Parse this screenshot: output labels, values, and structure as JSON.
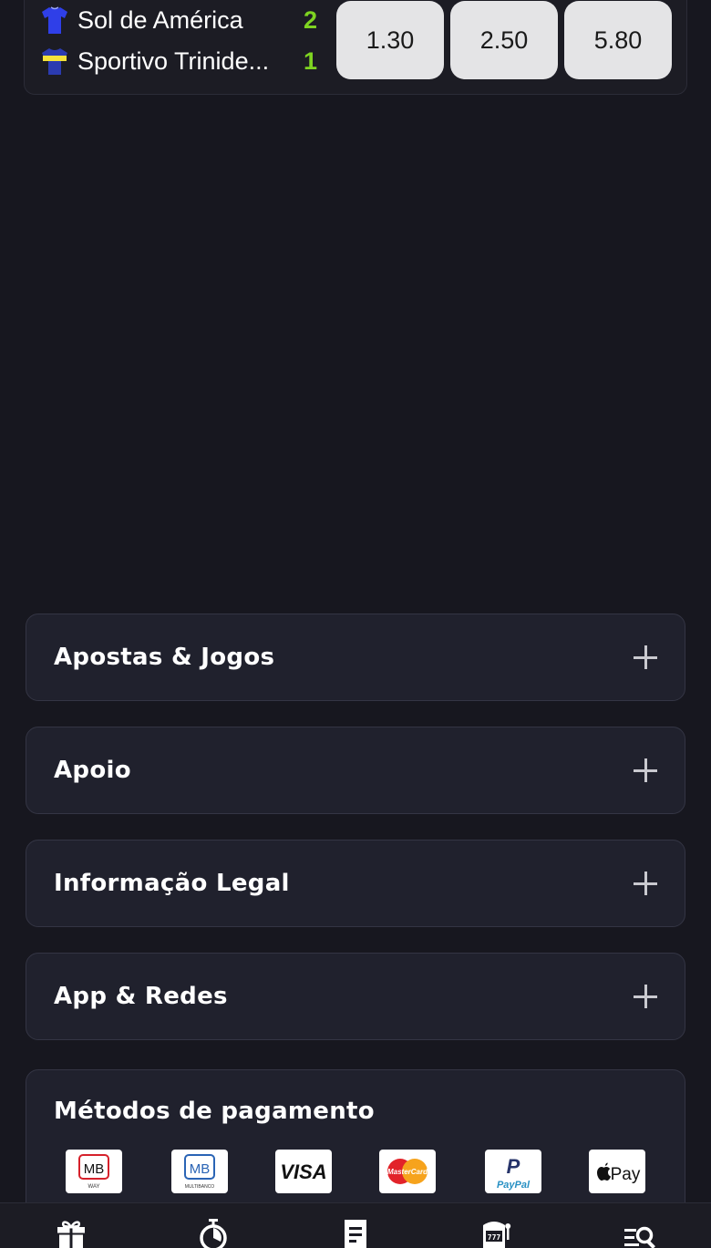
{
  "match": {
    "home": {
      "name": "Sol de América",
      "score": "2"
    },
    "away": {
      "name": "Sportivo Trinide...",
      "score": "1"
    },
    "odds": [
      "1.30",
      "2.50",
      "5.80"
    ]
  },
  "footer": {
    "sections": [
      {
        "title": "Apostas & Jogos"
      },
      {
        "title": "Apoio"
      },
      {
        "title": "Informação Legal"
      },
      {
        "title": "App & Redes"
      }
    ],
    "payment": {
      "title": "Métodos de pagamento",
      "methods": [
        {
          "name": "MB WAY",
          "mark": "MB",
          "sub": "WAY"
        },
        {
          "name": "Multibanco",
          "mark": "MB",
          "sub": "MULTIBANCO"
        },
        {
          "name": "VISA",
          "mark": "VISA"
        },
        {
          "name": "MasterCard",
          "mark": "MasterCard"
        },
        {
          "name": "PayPal",
          "mark": "PayPal"
        },
        {
          "name": "Apple Pay",
          "mark": "Pay"
        }
      ]
    }
  },
  "bottom_nav": [
    {
      "icon": "gift-icon"
    },
    {
      "icon": "stopwatch-icon"
    },
    {
      "icon": "betslip-icon"
    },
    {
      "icon": "slot-machine-icon"
    },
    {
      "icon": "search-list-icon"
    }
  ],
  "colors": {
    "background": "#17171f",
    "card": "#20212d",
    "score": "#7ed321",
    "odd_button": "#e4e4e6"
  }
}
